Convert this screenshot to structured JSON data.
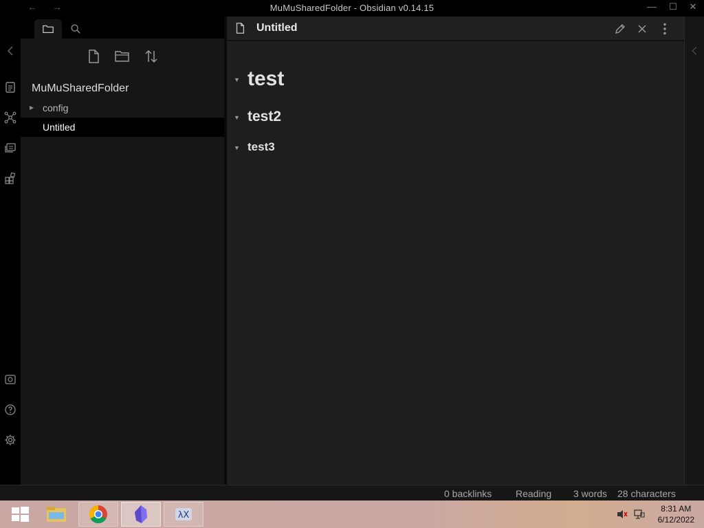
{
  "window": {
    "title": "MuMuSharedFolder - Obsidian v0.14.15",
    "back_glyph": "←",
    "forward_glyph": "→",
    "minimize_glyph": "—",
    "maximize_glyph": "☐",
    "close_glyph": "✕"
  },
  "ribbon": {
    "icons": [
      "collapse-sidebar-icon",
      "quick-switcher-icon",
      "graph-view-icon",
      "slides-icon",
      "templates-icon",
      "vault-icon",
      "help-icon",
      "settings-icon"
    ]
  },
  "sidebar": {
    "tabs": [
      "file-explorer",
      "search"
    ],
    "actions": [
      "new-note",
      "new-folder",
      "change-sort-order"
    ],
    "vault_name": "MuMuSharedFolder",
    "tree": [
      {
        "label": "config",
        "type": "folder",
        "collapsed": true
      },
      {
        "label": "Untitled",
        "type": "file",
        "active": true
      }
    ]
  },
  "editor": {
    "tab_title": "Untitled",
    "headings": [
      {
        "level": 1,
        "text": "test"
      },
      {
        "level": 2,
        "text": "test2"
      },
      {
        "level": 3,
        "text": "test3"
      }
    ],
    "actions": [
      "edit-icon",
      "close-icon",
      "more-options-icon"
    ]
  },
  "status": {
    "backlinks": "0 backlinks",
    "mode": "Reading",
    "words": "3 words",
    "characters": "28 characters"
  },
  "taskbar": {
    "apps": [
      "start",
      "file-explorer",
      "chrome",
      "obsidian",
      "xming"
    ],
    "time": "8:31 AM",
    "date": "6/12/2022"
  },
  "colors": {
    "accent": "#7f6df2",
    "background": "#1e1e1e",
    "sidebar": "#161616"
  }
}
